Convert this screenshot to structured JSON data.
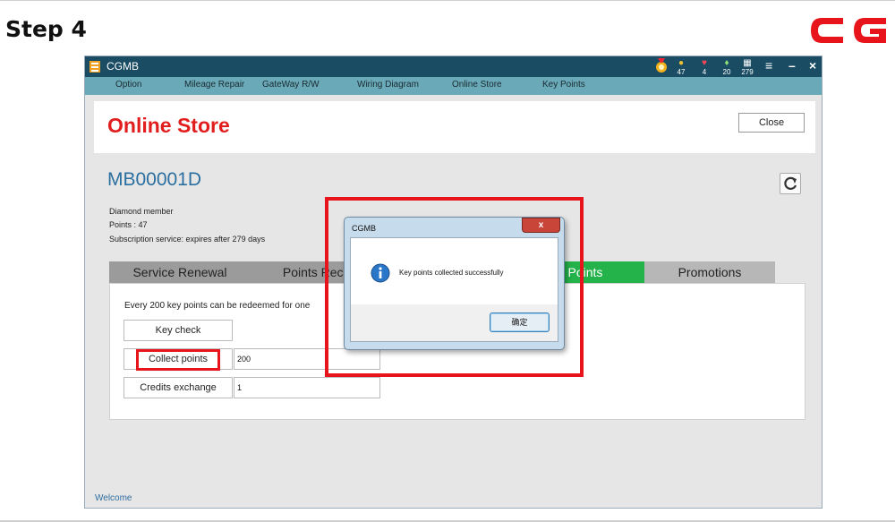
{
  "step_title": "Step 4",
  "logo": {
    "text": "CG",
    "color": "#e8141b"
  },
  "window": {
    "title": "CGMB",
    "stats": [
      {
        "icon": "medal-icon",
        "value": ""
      },
      {
        "icon": "coin-icon",
        "value": "47"
      },
      {
        "icon": "heart-icon",
        "value": "4"
      },
      {
        "icon": "diamond-icon",
        "value": "20"
      },
      {
        "icon": "calendar-icon",
        "value": "279"
      }
    ],
    "controls": {
      "menu": "≡",
      "minimize": "–",
      "close": "×"
    }
  },
  "menu": [
    "Option",
    "Mileage Repair",
    "GateWay R/W",
    "Wiring Diagram",
    "Online Store",
    "Key Points"
  ],
  "header": {
    "title": "Online Store",
    "close_label": "Close"
  },
  "account": {
    "id": "MB00001D",
    "member": "Diamond member",
    "points": "Points : 47",
    "subscription": "Subscription service: expires after 279 days"
  },
  "tabs": [
    "Service Renewal",
    "Points Recha",
    "y Points",
    "Promotions"
  ],
  "content": {
    "info": "Every 200 key points can be redeemed for one",
    "key_check": "Key check",
    "collect_points": "Collect points",
    "collect_value": "200",
    "credits_exchange": "Credits exchange",
    "credits_value": "1"
  },
  "status": "Welcome",
  "dialog": {
    "title": "CGMB",
    "close": "x",
    "message": "Key points collected successfully",
    "ok": "确定"
  },
  "colors": {
    "accent_red": "#e8141b",
    "title_bar": "#1a4c63",
    "menu_bar": "#6aa9b8",
    "active_tab": "#24b24a"
  }
}
